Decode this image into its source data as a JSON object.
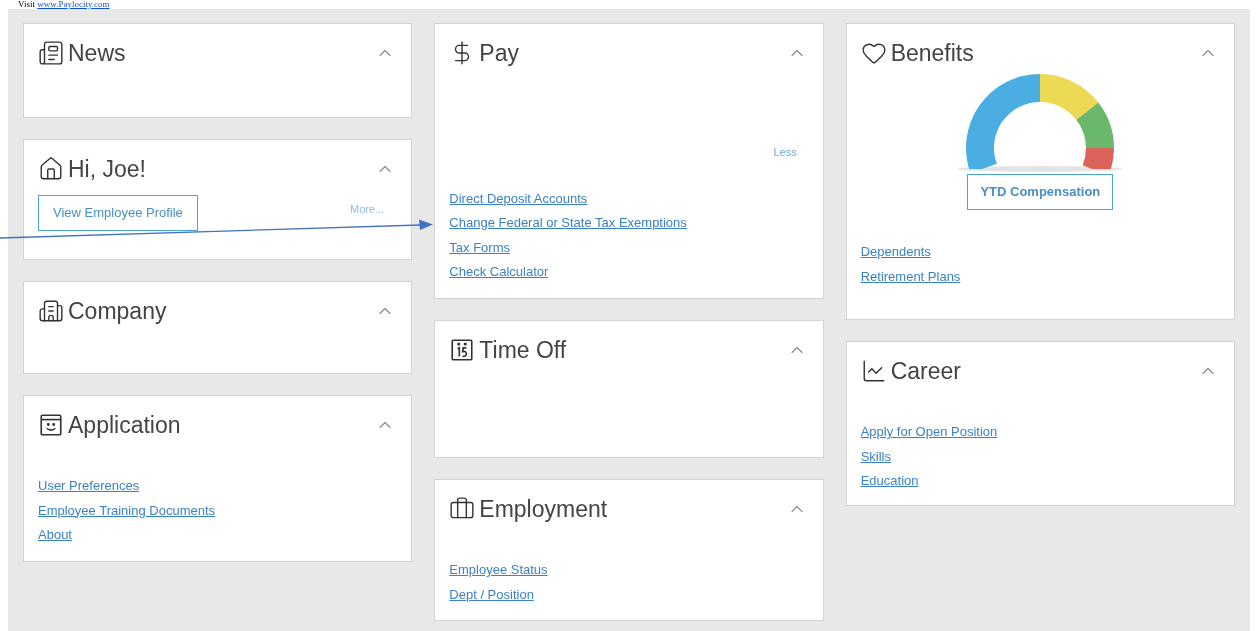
{
  "header_note": {
    "prefix": "Visit ",
    "link": "www.Paylocity.com"
  },
  "columns": [
    {
      "cards": [
        {
          "kind": "newspaper",
          "title": "News",
          "expanded": true
        },
        {
          "kind": "house",
          "title": "Hi, Joe!",
          "expanded": true,
          "button": "View Employee Profile",
          "more": "More..."
        },
        {
          "kind": "building",
          "title": "Company",
          "expanded": true
        },
        {
          "kind": "app-window",
          "title": "Application",
          "expanded": true,
          "links": [
            "User Preferences",
            "Employee Training Documents",
            "About"
          ]
        }
      ]
    },
    {
      "cards": [
        {
          "kind": "dollar",
          "title": "Pay",
          "expanded": true,
          "less": "Less",
          "links": [
            "Direct Deposit Accounts",
            "Change Federal or State Tax Exemptions",
            "Tax Forms",
            "Check Calculator"
          ]
        },
        {
          "kind": "calendar",
          "title": "Time Off",
          "expanded": true
        },
        {
          "kind": "briefcase",
          "title": "Employment",
          "expanded": true,
          "links": [
            "Employee Status",
            "Dept / Position"
          ]
        }
      ]
    },
    {
      "cards": [
        {
          "kind": "heart",
          "title": "Benefits",
          "expanded": true,
          "gauge": {
            "kind": "picture"
          },
          "button": "YTD Compensation",
          "links": [
            "Dependents",
            "Retirement Plans"
          ]
        },
        {
          "kind": "chart",
          "title": "Career",
          "expanded": true,
          "links": [
            "Apply for Open Position",
            "Skills",
            "Education"
          ]
        }
      ]
    }
  ]
}
